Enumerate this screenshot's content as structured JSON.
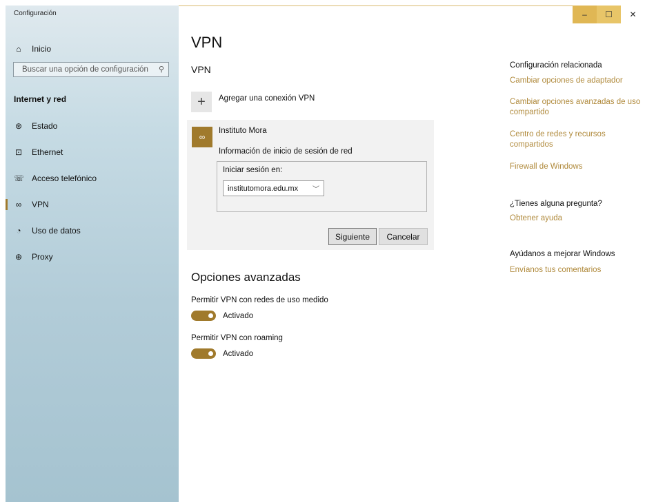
{
  "window": {
    "title": "Configuración",
    "controls": {
      "minimize": "–",
      "maximize": "☐",
      "close": "✕"
    }
  },
  "sidebar": {
    "home_label": "Inicio",
    "search_placeholder": "Buscar una opción de configuración",
    "section_title": "Internet y red",
    "items": [
      {
        "label": "Estado",
        "icon": "globe-icon"
      },
      {
        "label": "Ethernet",
        "icon": "ethernet-icon"
      },
      {
        "label": "Acceso telefónico",
        "icon": "phone-icon"
      },
      {
        "label": "VPN",
        "icon": "vpn-icon",
        "active": true
      },
      {
        "label": "Uso de datos",
        "icon": "data-usage-icon"
      },
      {
        "label": "Proxy",
        "icon": "proxy-icon"
      }
    ]
  },
  "main": {
    "page_title": "VPN",
    "section_title": "VPN",
    "add_connection_label": "Agregar una conexión VPN",
    "vpn_connection": {
      "name": "Instituto Mora",
      "info": "Información de inicio de sesión de red",
      "login_label": "Iniciar sesión en:",
      "login_value": "institutomora.edu.mx",
      "next_button": "Siguiente",
      "cancel_button": "Cancelar"
    },
    "advanced": {
      "title": "Opciones avanzadas",
      "metered": {
        "label": "Permitir VPN con redes de uso medido",
        "state": "Activado"
      },
      "roaming": {
        "label": "Permitir VPN con roaming",
        "state": "Activado"
      }
    }
  },
  "right_panel": {
    "related_title": "Configuración relacionada",
    "links": [
      "Cambiar opciones de adaptador",
      "Cambiar opciones avanzadas de uso compartido",
      "Centro de redes y recursos compartidos",
      "Firewall de Windows"
    ],
    "question_title": "¿Tienes alguna pregunta?",
    "help_link": "Obtener ayuda",
    "improve_title": "Ayúdanos a mejorar Windows",
    "feedback_link": "Envíanos tus comentarios"
  },
  "colors": {
    "accent": "#a07a2c",
    "link": "#b08a3c"
  }
}
